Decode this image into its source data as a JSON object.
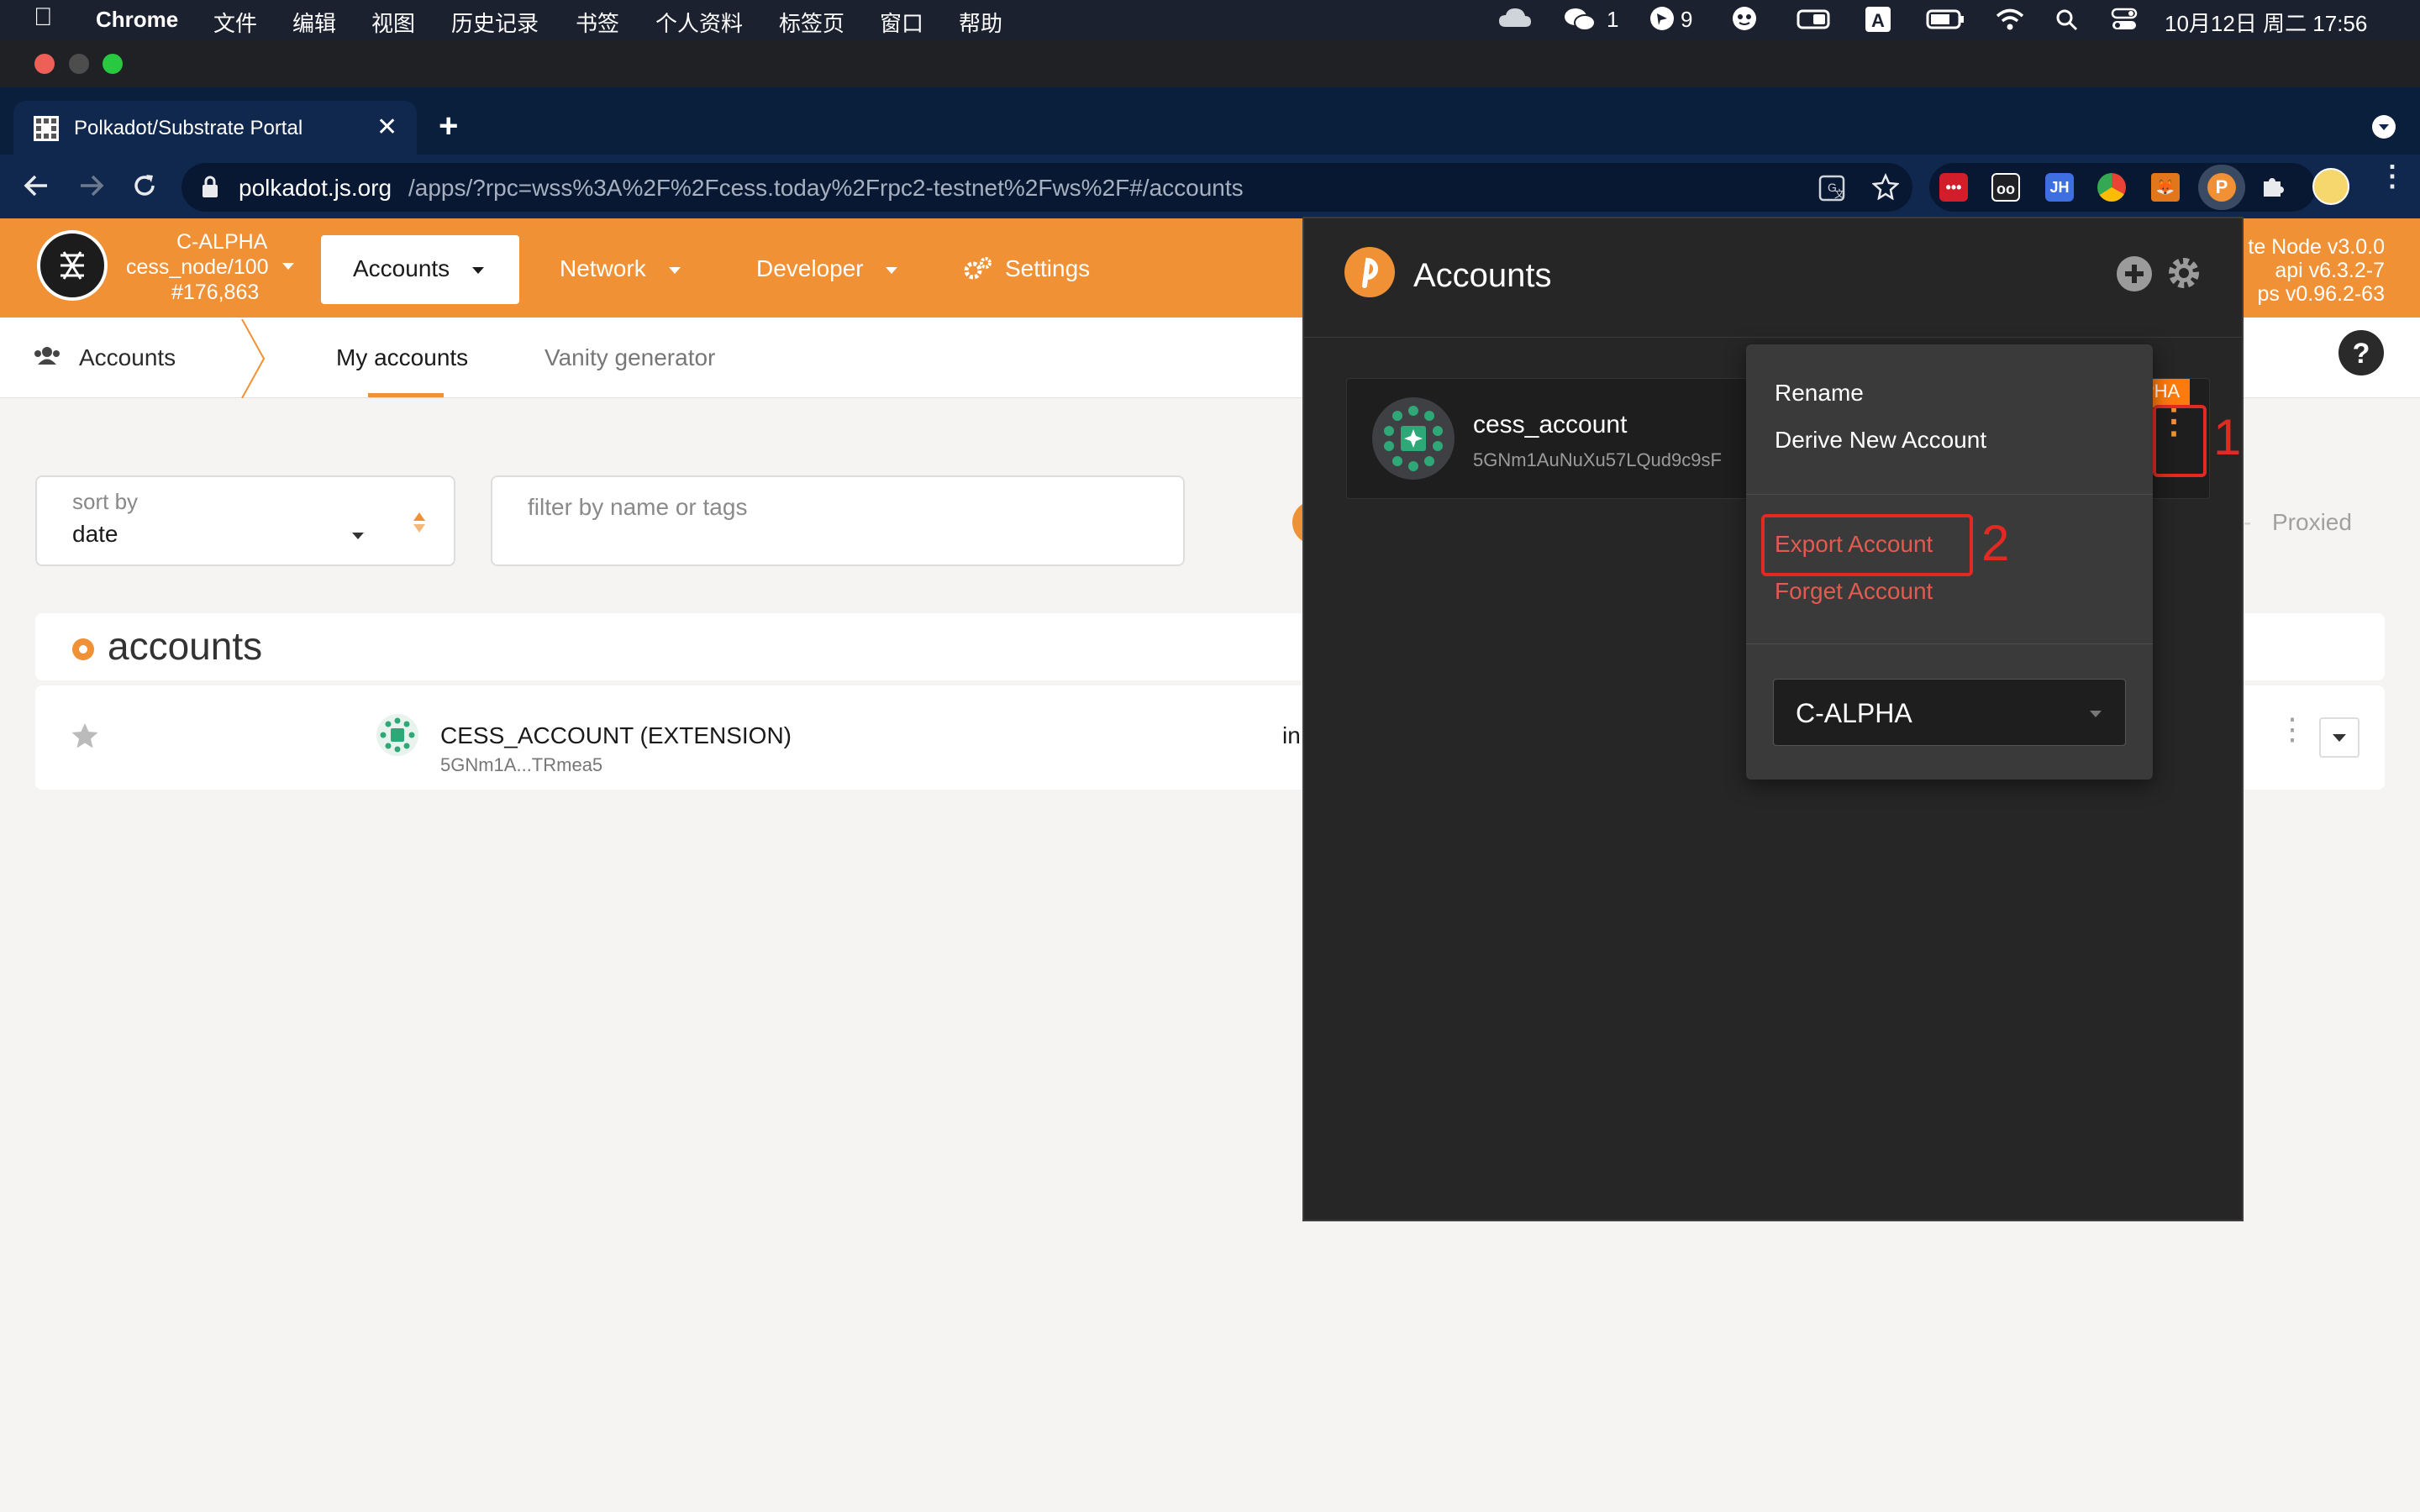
{
  "menubar": {
    "apple_icon": "apple-icon",
    "app_name": "Chrome",
    "items": [
      "文件",
      "编辑",
      "视图",
      "历史记录",
      "书签",
      "个人资料",
      "标签页",
      "窗口",
      "帮助"
    ],
    "wechat_count": "1",
    "badge_count": "9",
    "datetime": "10月12日 周二  17:56"
  },
  "browser": {
    "tab_title": "Polkadot/Substrate Portal",
    "url_domain": "polkadot.js.org",
    "url_path": "/apps/?rpc=wss%3A%2F%2Fcess.today%2Frpc2-testnet%2Fws%2F#/accounts",
    "ext_jh": "JH"
  },
  "portal": {
    "chain": {
      "name": "C-ALPHA",
      "node": "cess_node/100",
      "block": "#176,863"
    },
    "nav": {
      "accounts": "Accounts",
      "network": "Network",
      "developer": "Developer",
      "settings": "Settings"
    },
    "version": {
      "node": "te Node v3.0.0",
      "api": "api v6.3.2-7",
      "apps": "ps v0.96.2-63"
    },
    "subnav": {
      "section": "Accounts",
      "tabs": [
        "My accounts",
        "Vanity generator"
      ]
    },
    "sort": {
      "label": "sort by",
      "value": "date"
    },
    "filter_placeholder": "filter by name or tags",
    "proxied_label": "Proxied",
    "accounts_header": "accounts",
    "account_row": {
      "name": "CESS_ACCOUNT (EXTENSION)",
      "address": "5GNm1A...TRmea5",
      "type_partial": "in"
    }
  },
  "extension": {
    "title": "Accounts",
    "account": {
      "name": "cess_account",
      "address": "5GNm1AuNuXu57LQud9c9sF",
      "chain_tag": "PHA"
    },
    "menu": {
      "rename": "Rename",
      "derive": "Derive New Account",
      "export": "Export Account",
      "forget": "Forget Account",
      "network_value": "C-ALPHA"
    },
    "annotations": {
      "step1": "1",
      "step2": "2"
    }
  },
  "colors": {
    "accent_orange": "#f19135",
    "annotation_red": "#e22a22",
    "menu_red": "#e55a4f",
    "identicon_green": "#2fa878"
  }
}
